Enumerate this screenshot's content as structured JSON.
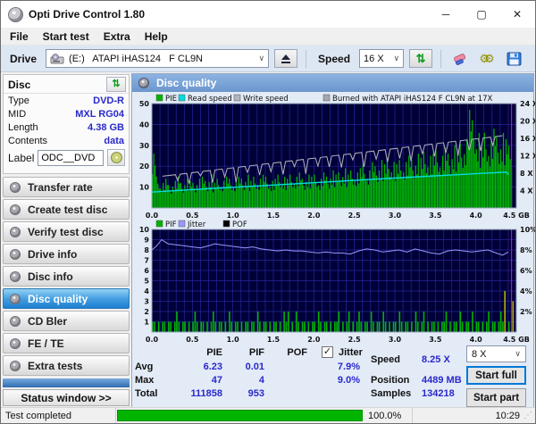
{
  "window": {
    "title": "Opti Drive Control 1.80",
    "minimize": "─",
    "maximize": "▢",
    "close": "✕"
  },
  "menu": {
    "items": [
      "File",
      "Start test",
      "Extra",
      "Help"
    ]
  },
  "toolbar": {
    "drive_label": "Drive",
    "drive_value": "(E:)   ATAPI iHAS124   F CL9N",
    "speed_label": "Speed",
    "speed_value": "16 X"
  },
  "sidebar": {
    "disc_panel": {
      "title": "Disc",
      "fields": [
        {
          "label": "Type",
          "value": "DVD-R"
        },
        {
          "label": "MID",
          "value": "MXL RG04"
        },
        {
          "label": "Length",
          "value": "4.38 GB"
        },
        {
          "label": "Contents",
          "value": "data"
        }
      ],
      "label_label": "Label",
      "label_value": "ODC__DVD"
    },
    "buttons": [
      {
        "label": "Transfer rate"
      },
      {
        "label": "Create test disc"
      },
      {
        "label": "Verify test disc"
      },
      {
        "label": "Drive info"
      },
      {
        "label": "Disc info"
      },
      {
        "label": "Disc quality"
      },
      {
        "label": "CD Bler"
      },
      {
        "label": "FE / TE"
      },
      {
        "label": "Extra tests"
      }
    ],
    "status_window_label": "Status window >>"
  },
  "main": {
    "header": "Disc quality"
  },
  "stats": {
    "col_pie": "PIE",
    "col_pif": "PIF",
    "col_pof": "POF",
    "jitter_label": "Jitter",
    "jitter_checked": "✓",
    "rows": [
      {
        "label": "Avg",
        "pie": "6.23",
        "pif": "0.01",
        "pof": "",
        "jitter": "7.9%"
      },
      {
        "label": "Max",
        "pie": "47",
        "pif": "4",
        "pof": "",
        "jitter": "9.0%"
      },
      {
        "label": "Total",
        "pie": "111858",
        "pif": "953",
        "pof": "",
        "jitter": ""
      }
    ],
    "speed_label": "Speed",
    "speed_value": "8.25 X",
    "position_label": "Position",
    "position_value": "4489 MB",
    "samples_label": "Samples",
    "samples_value": "134218",
    "speed_select": "8 X",
    "start_full_label": "Start full",
    "start_part_label": "Start part"
  },
  "statusbar": {
    "status": "Test completed",
    "progress": "100.0%",
    "progress_value": 100,
    "time": "10:29"
  },
  "chart_data": [
    {
      "name": "pie-read-write-chart",
      "type": "bar",
      "title": "",
      "legend": [
        {
          "label": "PIE",
          "color": "#00b400"
        },
        {
          "label": "Read speed",
          "color": "#00dede"
        },
        {
          "label": "Write speed",
          "color": "#b4b4bc"
        },
        {
          "label": "Burned with ATAPI iHAS124   F CL9N at 17X",
          "color": "#a6a6ae"
        }
      ],
      "xlim": [
        0,
        4.5
      ],
      "x_ticks": [
        0,
        0.5,
        1,
        1.5,
        2,
        2.5,
        3,
        3.5,
        4,
        4.5
      ],
      "x_tick_labels": [
        "0.0",
        "0.5",
        "1.0",
        "1.5",
        "2.0",
        "2.5",
        "3.0",
        "3.5",
        "4.0",
        "4.5 GB"
      ],
      "ylim_left": [
        0,
        50
      ],
      "y_ticks_left": [
        10,
        20,
        30,
        40,
        50
      ],
      "right_axis_max": 24,
      "y_ticks_right_values": [
        4,
        8,
        12,
        16,
        20,
        24
      ],
      "y_ticks_right_labels": [
        "4 X",
        "8 X",
        "12 X",
        "16 X",
        "20 X",
        "24 X"
      ],
      "grid_x_step": 0.1,
      "grid_y_step": 10,
      "marker_x": 4.44,
      "marker_color": "#cc00cc",
      "bar_color": "#00b400",
      "pie_bar_step": 0.05,
      "pie_bars": [
        26,
        15,
        12,
        14,
        11,
        13,
        15,
        12,
        14,
        13,
        12,
        14,
        15,
        13,
        16,
        12,
        14,
        13,
        15,
        14,
        13,
        15,
        14,
        16,
        13,
        15,
        14,
        16,
        15,
        13,
        14,
        16,
        15,
        14,
        16,
        15,
        17,
        14,
        16,
        15,
        16,
        14,
        17,
        15,
        18,
        16,
        17,
        19,
        16,
        18,
        17,
        19,
        21,
        18,
        22,
        20,
        23,
        21,
        24,
        22,
        21,
        23,
        22,
        25,
        23,
        26,
        24,
        27,
        25,
        26,
        28,
        25,
        29,
        26,
        30,
        28,
        31,
        33,
        47,
        42,
        36,
        31,
        36,
        32,
        38,
        34,
        36,
        33,
        30
      ],
      "read_speed_points": [
        [
          0,
          7.6
        ],
        [
          0.5,
          8.8
        ],
        [
          1,
          9.9
        ],
        [
          1.5,
          11
        ],
        [
          2,
          12.1
        ],
        [
          2.5,
          13.2
        ],
        [
          3,
          14.3
        ],
        [
          3.5,
          15.4
        ],
        [
          4,
          16.4
        ],
        [
          4.3,
          17
        ],
        [
          4.38,
          17.2
        ],
        [
          4.4,
          16
        ]
      ],
      "write_speed": {
        "x_start": 0.13,
        "y_start": 15.2,
        "x_end": 4.33,
        "y_end": 34.6,
        "dips": [
          [
            0.32,
            3
          ],
          [
            0.46,
            5
          ],
          [
            0.6,
            2
          ],
          [
            0.75,
            6
          ],
          [
            0.9,
            4
          ],
          [
            1.04,
            7
          ],
          [
            1.18,
            3
          ],
          [
            1.33,
            5
          ],
          [
            1.47,
            4
          ],
          [
            1.62,
            6
          ],
          [
            1.76,
            3
          ],
          [
            1.9,
            7
          ],
          [
            2.05,
            4
          ],
          [
            2.19,
            5
          ],
          [
            2.34,
            6
          ],
          [
            2.48,
            3
          ],
          [
            2.62,
            7
          ],
          [
            2.77,
            4
          ],
          [
            2.91,
            6
          ],
          [
            3.06,
            5
          ],
          [
            3.2,
            7
          ],
          [
            3.34,
            4
          ],
          [
            3.49,
            6
          ],
          [
            3.63,
            5
          ],
          [
            3.78,
            7
          ],
          [
            3.92,
            5
          ],
          [
            4.06,
            6
          ],
          [
            4.21,
            4
          ]
        ]
      }
    },
    {
      "name": "pif-jitter-pof-chart",
      "type": "bar",
      "title": "",
      "legend": [
        {
          "label": "PIF",
          "color": "#00b400"
        },
        {
          "label": "Jitter",
          "color": "#9898ff"
        },
        {
          "label": "POF",
          "color": "#000000"
        }
      ],
      "xlim": [
        0,
        4.5
      ],
      "x_ticks": [
        0,
        0.5,
        1,
        1.5,
        2,
        2.5,
        3,
        3.5,
        4,
        4.5
      ],
      "x_tick_labels": [
        "0.0",
        "0.5",
        "1.0",
        "1.5",
        "2.0",
        "2.5",
        "3.0",
        "3.5",
        "4.0",
        "4.5 GB"
      ],
      "ylim_left": [
        0,
        10
      ],
      "y_ticks_left": [
        1,
        2,
        3,
        4,
        5,
        6,
        7,
        8,
        9,
        10
      ],
      "y_ticks_right_values": [
        2,
        4,
        6,
        8,
        10
      ],
      "y_ticks_right_labels": [
        "2%",
        "4%",
        "6%",
        "8%",
        "10%"
      ],
      "grid_x_step": 0.1,
      "grid_y_step": 1,
      "marker_x": 4.44,
      "marker_color": "#cc00cc",
      "bar_color": "#00b400",
      "pif_high_color": "#b0b000",
      "pif_bar_step": 0.025,
      "pif_bars": [
        1,
        1,
        0,
        1,
        0,
        1,
        1,
        0,
        1,
        1,
        0,
        1,
        2,
        1,
        0,
        1,
        1,
        0,
        1,
        0,
        1,
        2,
        1,
        0,
        1,
        1,
        0,
        1,
        0,
        1,
        2,
        1,
        0,
        1,
        1,
        0,
        1,
        0,
        2,
        1,
        0,
        1,
        1,
        0,
        1,
        0,
        1,
        1,
        0,
        1,
        1,
        0,
        2,
        1,
        0,
        1,
        1,
        0,
        1,
        0,
        1,
        1,
        0,
        1,
        0,
        2,
        1,
        2,
        0,
        1,
        0,
        2,
        1,
        0,
        1,
        1,
        0,
        1,
        0,
        1,
        1,
        0,
        2,
        1,
        0,
        1,
        1,
        0,
        1,
        0,
        1,
        1,
        2,
        0,
        1,
        0,
        1,
        2,
        0,
        1,
        0,
        1,
        2,
        1,
        0,
        1,
        1,
        0,
        2,
        1,
        0,
        1,
        1,
        0,
        2,
        1,
        0,
        1,
        0,
        1,
        1,
        0,
        2,
        1,
        0,
        1,
        1,
        0,
        1,
        0,
        2,
        1,
        0,
        1,
        2,
        0,
        1,
        0,
        1,
        1,
        0,
        1,
        0,
        1,
        1,
        2,
        0,
        1,
        0,
        1,
        1,
        0,
        2,
        1,
        0,
        1,
        1,
        0,
        2,
        0,
        1,
        1,
        0,
        1,
        0,
        1,
        2,
        0,
        1,
        1,
        0,
        1,
        2,
        1,
        4,
        0,
        1,
        0,
        3
      ],
      "jitter_points": [
        [
          0,
          8.0
        ],
        [
          0.06,
          8.4
        ],
        [
          0.12,
          9.0
        ],
        [
          0.2,
          8.6
        ],
        [
          0.3,
          8.5
        ],
        [
          0.4,
          8.4
        ],
        [
          0.5,
          8.3
        ],
        [
          0.6,
          8.2
        ],
        [
          0.7,
          8.4
        ],
        [
          0.78,
          8.6
        ],
        [
          0.85,
          8.5
        ],
        [
          0.95,
          8.4
        ],
        [
          1.05,
          8.3
        ],
        [
          1.15,
          8.2
        ],
        [
          1.25,
          8.3
        ],
        [
          1.35,
          8.1
        ],
        [
          1.45,
          8.0
        ],
        [
          1.55,
          7.9
        ],
        [
          1.65,
          8.0
        ],
        [
          1.75,
          7.9
        ],
        [
          1.85,
          7.9
        ],
        [
          1.95,
          7.8
        ],
        [
          2.05,
          7.7
        ],
        [
          2.15,
          7.8
        ],
        [
          2.25,
          7.7
        ],
        [
          2.35,
          7.7
        ],
        [
          2.45,
          7.6
        ],
        [
          2.55,
          7.9
        ],
        [
          2.65,
          8.1
        ],
        [
          2.75,
          8.0
        ],
        [
          2.85,
          7.8
        ],
        [
          2.95,
          7.9
        ],
        [
          3.05,
          8.0
        ],
        [
          3.15,
          7.8
        ],
        [
          3.25,
          8.1
        ],
        [
          3.35,
          7.9
        ],
        [
          3.45,
          7.7
        ],
        [
          3.55,
          7.6
        ],
        [
          3.65,
          7.9
        ],
        [
          3.75,
          8.0
        ],
        [
          3.85,
          7.9
        ],
        [
          3.95,
          7.8
        ],
        [
          4.05,
          7.9
        ],
        [
          4.15,
          8.0
        ],
        [
          4.25,
          7.7
        ],
        [
          4.33,
          7.5
        ],
        [
          4.4,
          7.8
        ]
      ]
    }
  ]
}
